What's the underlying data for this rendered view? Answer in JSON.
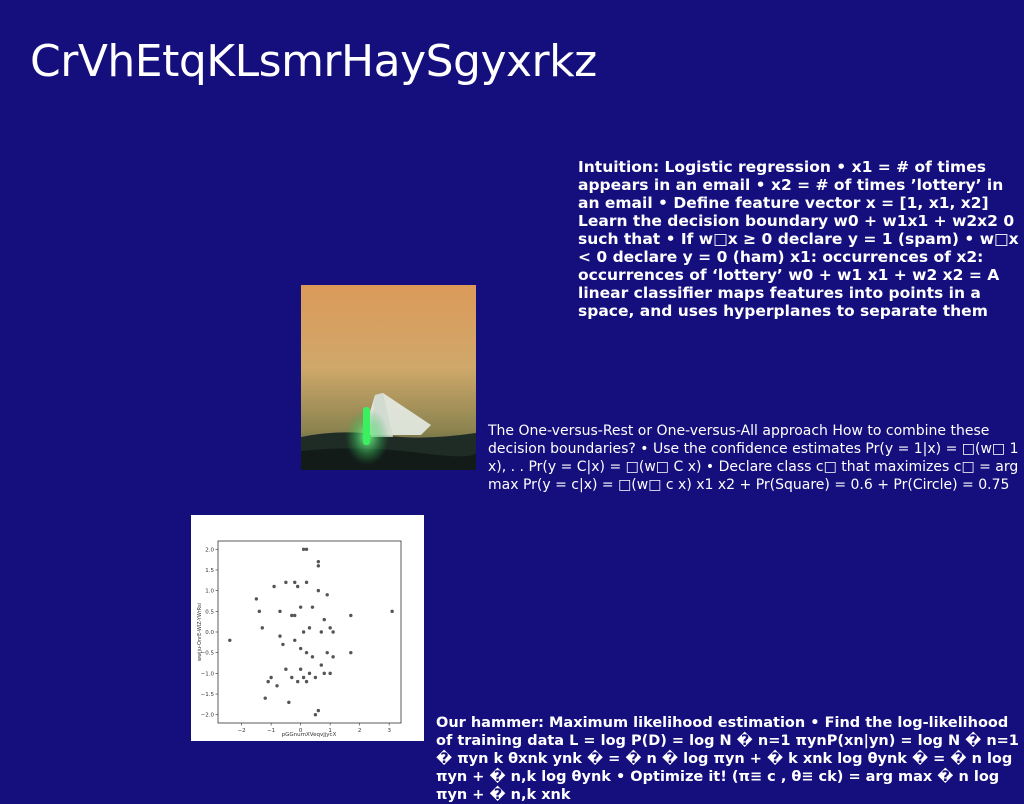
{
  "slide": {
    "title": "CrVhEtqKLsmrHaySgyxrkz",
    "background_color": "#150e7d",
    "text_color": "#ffffff"
  },
  "text_blocks": {
    "logistic": "Intuition: Logistic regression • x1 = # of times appears in an email • x2 = # of times ’lottery’ in an email • Define feature vector x = [1, x1, x2] Learn the decision boundary w0 + w1x1 + w2x2 0 such that • If w□x ≥ 0 declare y = 1 (spam) • w□x < 0 declare y = 0 (ham) x1: occurrences of x2: occurrences of ‘lottery’ w0 + w1 x1 + w2 x2 = A linear classifier maps features into points in a space, and uses hyperplanes to separate them",
    "ovr": "The One-versus-Rest or One-versus-All approach How to combine these decision boundaries? • Use the confidence estimates Pr(y = 1|x) = □(w□ 1 x), . . Pr(y = C|x) = □(w□ C x) • Declare class c□ that maximizes c□ = arg max Pr(y = c|x) = □(w□ c x) x1 x2 + Pr(Square) = 0.6 + Pr(Circle) = 0.75",
    "mle": "Our hammer: Maximum likelihood estimation • Find the log-likelihood of training data L = log P(D) = log N � n=1 πynP(xn|yn) = log N � n=1 � πyn k θxnk ynk � = � n � log πyn + � k xnk log θynk � = � n log πyn + � n,k log θynk • Optimize it! (π≡ c , θ≡ ck) = arg max � n log πyn + � n,k xnk"
  },
  "images": {
    "photo": {
      "description_icon": "tent-photo",
      "colors": {
        "sky_top": "#e2a25c",
        "sky_bottom": "#6a6a3a",
        "ground": "#1d2a24",
        "tent": "#dfe7e0",
        "glow": "#3cff6a"
      }
    }
  },
  "chart_data": {
    "type": "scatter",
    "xlabel": "pGGnumXVeqvjjycX",
    "ylabel": "wwjju-OnrE-WIZ-YWrRsi",
    "xlim": [
      -2.8,
      3.4
    ],
    "ylim": [
      -2.2,
      2.2
    ],
    "x_ticks": [
      -2,
      -1,
      0,
      1,
      2,
      3
    ],
    "y_ticks": [
      -2.0,
      -1.5,
      -1.0,
      -0.5,
      0.0,
      0.5,
      1.0,
      1.5,
      2.0
    ],
    "x_tick_labels": [
      "−2",
      "−1",
      "0",
      "1",
      "2",
      "3"
    ],
    "y_tick_labels": [
      "−2.0",
      "−1.5",
      "−1.0",
      "−0.5",
      "0.0",
      "0.5",
      "1.0",
      "1.5",
      "2.0"
    ],
    "grid": false,
    "point_color": "#555555",
    "points": [
      {
        "x": -2.4,
        "y": -0.2
      },
      {
        "x": -1.5,
        "y": 0.8
      },
      {
        "x": -1.4,
        "y": 0.5
      },
      {
        "x": -1.3,
        "y": 0.1
      },
      {
        "x": -1.2,
        "y": -1.6
      },
      {
        "x": -1.0,
        "y": -1.1
      },
      {
        "x": -0.9,
        "y": 1.1
      },
      {
        "x": -0.8,
        "y": -1.3
      },
      {
        "x": -0.7,
        "y": 0.5
      },
      {
        "x": -0.7,
        "y": -0.1
      },
      {
        "x": -0.6,
        "y": -0.3
      },
      {
        "x": -0.5,
        "y": 1.2
      },
      {
        "x": -0.5,
        "y": -0.9
      },
      {
        "x": -0.4,
        "y": -1.7
      },
      {
        "x": -0.3,
        "y": 0.4
      },
      {
        "x": -0.3,
        "y": -1.1
      },
      {
        "x": -0.2,
        "y": 1.2
      },
      {
        "x": -0.2,
        "y": 0.4
      },
      {
        "x": -0.2,
        "y": -0.2
      },
      {
        "x": -0.1,
        "y": 1.1
      },
      {
        "x": -0.1,
        "y": -1.2
      },
      {
        "x": 0.0,
        "y": 0.6
      },
      {
        "x": 0.0,
        "y": -0.9
      },
      {
        "x": 0.0,
        "y": -0.4
      },
      {
        "x": 0.1,
        "y": 2.0
      },
      {
        "x": 0.1,
        "y": 0.0
      },
      {
        "x": 0.1,
        "y": -1.1
      },
      {
        "x": 0.2,
        "y": 1.2
      },
      {
        "x": 0.2,
        "y": -0.5
      },
      {
        "x": 0.2,
        "y": -1.2
      },
      {
        "x": 0.3,
        "y": 0.1
      },
      {
        "x": 0.3,
        "y": -1.0
      },
      {
        "x": 0.4,
        "y": 0.6
      },
      {
        "x": 0.4,
        "y": -0.6
      },
      {
        "x": 0.5,
        "y": -1.1
      },
      {
        "x": 0.5,
        "y": -2.0
      },
      {
        "x": 0.6,
        "y": 1.6
      },
      {
        "x": 0.6,
        "y": 1.0
      },
      {
        "x": 0.6,
        "y": -1.9
      },
      {
        "x": 0.7,
        "y": -0.8
      },
      {
        "x": 0.7,
        "y": 0.0
      },
      {
        "x": 0.8,
        "y": 0.3
      },
      {
        "x": 0.8,
        "y": -1.0
      },
      {
        "x": 0.9,
        "y": -0.5
      },
      {
        "x": 0.9,
        "y": 0.9
      },
      {
        "x": 1.0,
        "y": -1.0
      },
      {
        "x": 1.1,
        "y": 0.0
      },
      {
        "x": 1.1,
        "y": -0.6
      },
      {
        "x": 1.7,
        "y": 0.4
      },
      {
        "x": 1.7,
        "y": -0.5
      },
      {
        "x": 3.1,
        "y": 0.5
      },
      {
        "x": 0.2,
        "y": 2.0
      },
      {
        "x": 0.6,
        "y": 1.7
      },
      {
        "x": -1.1,
        "y": -1.2
      },
      {
        "x": 1.0,
        "y": 0.1
      }
    ]
  }
}
